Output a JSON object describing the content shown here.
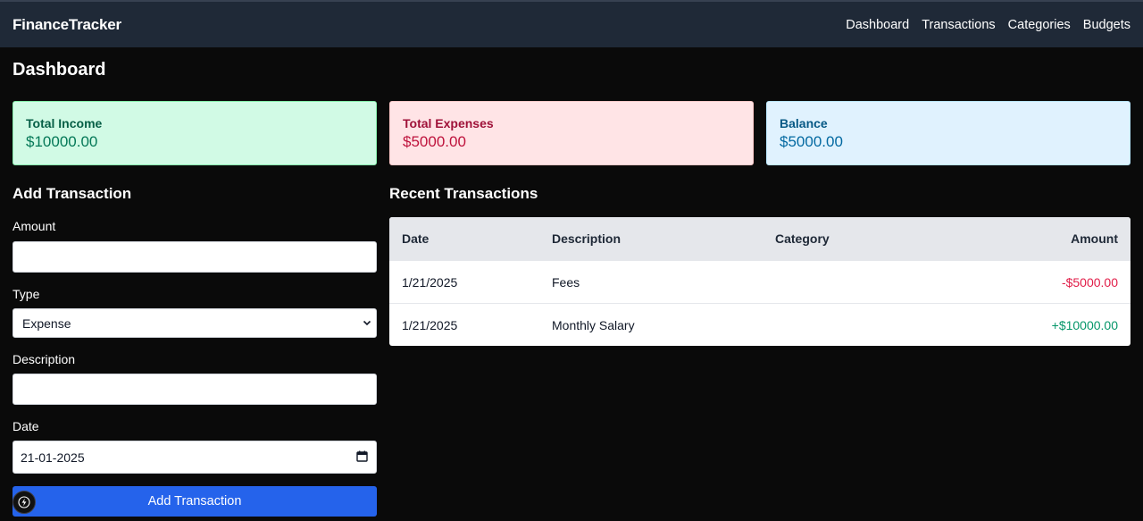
{
  "app": {
    "brand": "FinanceTracker",
    "nav": [
      "Dashboard",
      "Transactions",
      "Categories",
      "Budgets"
    ]
  },
  "page": {
    "title": "Dashboard"
  },
  "summary": {
    "income": {
      "label": "Total Income",
      "value": "$10000.00"
    },
    "expenses": {
      "label": "Total Expenses",
      "value": "$5000.00"
    },
    "balance": {
      "label": "Balance",
      "value": "$5000.00"
    }
  },
  "form": {
    "title": "Add Transaction",
    "amount_label": "Amount",
    "amount_value": "",
    "type_label": "Type",
    "type_value": "Expense",
    "description_label": "Description",
    "description_value": "",
    "date_label": "Date",
    "date_value": "21-01-2025",
    "submit_label": "Add Transaction"
  },
  "transactions": {
    "title": "Recent Transactions",
    "columns": [
      "Date",
      "Description",
      "Category",
      "Amount"
    ],
    "rows": [
      {
        "date": "1/21/2025",
        "description": "Fees",
        "category": "",
        "amount": "-$5000.00",
        "kind": "expense"
      },
      {
        "date": "1/21/2025",
        "description": "Monthly Salary",
        "category": "",
        "amount": "+$10000.00",
        "kind": "income"
      }
    ]
  },
  "colors": {
    "nav_bg": "#1f2937",
    "primary_button": "#2563eb",
    "income_text": "#059669",
    "expense_text": "#e11d48"
  },
  "icons": {
    "select_arrow": "chevron-down-icon",
    "date_picker": "calendar-icon",
    "dev_badge": "lightning-icon"
  }
}
